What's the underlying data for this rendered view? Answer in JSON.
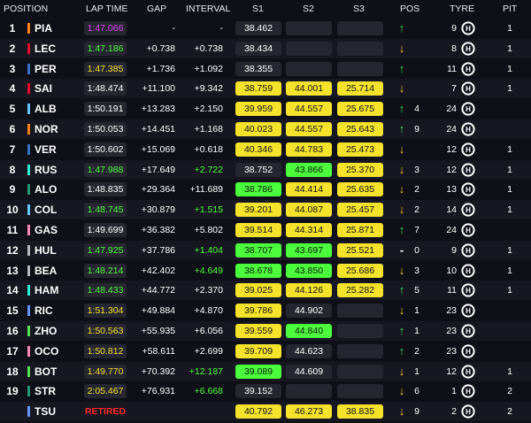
{
  "headers": {
    "position": "POSITION",
    "lap_time": "LAP TIME",
    "gap": "GAP",
    "interval": "INTERVAL",
    "s1": "S1",
    "s2": "S2",
    "s3": "S3",
    "pos": "POS",
    "tyre": "TYRE",
    "pit": "PIT"
  },
  "colors": {
    "purple": "#e040fb",
    "green": "#4cff3c",
    "yellow": "#f5e22a",
    "gray_box": "#262631",
    "white": "#ffffff",
    "red": "#ff2a2a",
    "arrow_up": "#3dd95a",
    "arrow_down": "#f5c518",
    "tyre_hard": "#ffffff"
  },
  "rows": [
    {
      "pos": "1",
      "code": "PIA",
      "team": "#ff8000",
      "lap": "1:47.066",
      "lap_c": "purple",
      "gap": "-",
      "int": "-",
      "int_c": "white",
      "s1": "38.462",
      "s1_c": "gray",
      "s2": "",
      "s2_c": "gray",
      "s3": "",
      "s3_c": "gray",
      "arrow": "↑",
      "arrow_c": "up",
      "gl": "",
      "age": "9",
      "tyre": "H",
      "pit": "1"
    },
    {
      "pos": "2",
      "code": "LEC",
      "team": "#e8002d",
      "lap": "1:47.186",
      "lap_c": "green",
      "gap": "+0.738",
      "int": "+0.738",
      "int_c": "white",
      "s1": "38.434",
      "s1_c": "gray",
      "s2": "",
      "s2_c": "gray",
      "s3": "",
      "s3_c": "gray",
      "arrow": "↓",
      "arrow_c": "down",
      "gl": "",
      "age": "8",
      "tyre": "H",
      "pit": "1"
    },
    {
      "pos": "3",
      "code": "PER",
      "team": "#3671c6",
      "lap": "1:47.385",
      "lap_c": "yellow",
      "gap": "+1.736",
      "int": "+1.092",
      "int_c": "white",
      "s1": "38.355",
      "s1_c": "gray",
      "s2": "",
      "s2_c": "gray",
      "s3": "",
      "s3_c": "gray",
      "arrow": "↑",
      "arrow_c": "up",
      "gl": "",
      "age": "11",
      "tyre": "H",
      "pit": "1"
    },
    {
      "pos": "4",
      "code": "SAI",
      "team": "#e8002d",
      "lap": "1:48.474",
      "lap_c": "gray",
      "gap": "+11.100",
      "int": "+9.342",
      "int_c": "white",
      "s1": "38.759",
      "s1_c": "yellow",
      "s2": "44.001",
      "s2_c": "yellow",
      "s3": "25.714",
      "s3_c": "yellow",
      "arrow": "↓",
      "arrow_c": "down",
      "gl": "",
      "age": "7",
      "tyre": "H",
      "pit": "1"
    },
    {
      "pos": "5",
      "code": "ALB",
      "team": "#64c4ff",
      "lap": "1:50.191",
      "lap_c": "gray",
      "gap": "+13.283",
      "int": "+2.150",
      "int_c": "white",
      "s1": "39.959",
      "s1_c": "yellow",
      "s2": "44.557",
      "s2_c": "yellow",
      "s3": "25.675",
      "s3_c": "yellow",
      "arrow": "↑",
      "arrow_c": "up",
      "gl": "4",
      "age": "24",
      "tyre": "H",
      "pit": ""
    },
    {
      "pos": "6",
      "code": "NOR",
      "team": "#ff8000",
      "lap": "1:50.053",
      "lap_c": "gray",
      "gap": "+14.451",
      "int": "+1.168",
      "int_c": "white",
      "s1": "40.023",
      "s1_c": "yellow",
      "s2": "44.557",
      "s2_c": "yellow",
      "s3": "25.643",
      "s3_c": "yellow",
      "arrow": "↑",
      "arrow_c": "up",
      "gl": "9",
      "age": "24",
      "tyre": "H",
      "pit": ""
    },
    {
      "pos": "7",
      "code": "VER",
      "team": "#3671c6",
      "lap": "1:50.602",
      "lap_c": "gray",
      "gap": "+15.069",
      "int": "+0.618",
      "int_c": "white",
      "s1": "40.346",
      "s1_c": "yellow",
      "s2": "44.783",
      "s2_c": "yellow",
      "s3": "25.473",
      "s3_c": "yellow",
      "arrow": "↓",
      "arrow_c": "down",
      "gl": "",
      "age": "12",
      "tyre": "H",
      "pit": "1"
    },
    {
      "pos": "8",
      "code": "RUS",
      "team": "#27f4d2",
      "lap": "1:47.988",
      "lap_c": "green",
      "gap": "+17.649",
      "int": "+2.722",
      "int_c": "green",
      "s1": "38.752",
      "s1_c": "gray",
      "s2": "43.866",
      "s2_c": "green",
      "s3": "25.370",
      "s3_c": "yellow",
      "arrow": "↓",
      "arrow_c": "down",
      "gl": "3",
      "age": "12",
      "tyre": "H",
      "pit": "1"
    },
    {
      "pos": "9",
      "code": "ALO",
      "team": "#229971",
      "lap": "1:48.835",
      "lap_c": "gray",
      "gap": "+29.364",
      "int": "+11.689",
      "int_c": "white",
      "s1": "38.786",
      "s1_c": "green",
      "s2": "44.414",
      "s2_c": "yellow",
      "s3": "25.635",
      "s3_c": "yellow",
      "arrow": "↓",
      "arrow_c": "down",
      "gl": "2",
      "age": "13",
      "tyre": "H",
      "pit": "1"
    },
    {
      "pos": "10",
      "code": "COL",
      "team": "#64c4ff",
      "lap": "1:48.745",
      "lap_c": "green",
      "gap": "+30.879",
      "int": "+1.515",
      "int_c": "green",
      "s1": "39.201",
      "s1_c": "yellow",
      "s2": "44.087",
      "s2_c": "yellow",
      "s3": "25.457",
      "s3_c": "yellow",
      "arrow": "↓",
      "arrow_c": "down",
      "gl": "2",
      "age": "14",
      "tyre": "H",
      "pit": "1"
    },
    {
      "pos": "11",
      "code": "GAS",
      "team": "#ff87bc",
      "lap": "1:49.699",
      "lap_c": "gray",
      "gap": "+36.382",
      "int": "+5.802",
      "int_c": "white",
      "s1": "39.514",
      "s1_c": "yellow",
      "s2": "44.314",
      "s2_c": "yellow",
      "s3": "25.871",
      "s3_c": "yellow",
      "arrow": "↑",
      "arrow_c": "up",
      "gl": "7",
      "age": "24",
      "tyre": "H",
      "pit": ""
    },
    {
      "pos": "12",
      "code": "HUL",
      "team": "#b6babd",
      "lap": "1:47.925",
      "lap_c": "green",
      "gap": "+37.786",
      "int": "+1.404",
      "int_c": "green",
      "s1": "38.707",
      "s1_c": "green",
      "s2": "43.697",
      "s2_c": "green",
      "s3": "25.521",
      "s3_c": "yellow",
      "arrow": "-",
      "arrow_c": "neutral",
      "gl": "0",
      "age": "9",
      "tyre": "H",
      "pit": "1"
    },
    {
      "pos": "13",
      "code": "BEA",
      "team": "#b6babd",
      "lap": "1:48.214",
      "lap_c": "green",
      "gap": "+42.402",
      "int": "+4.649",
      "int_c": "green",
      "s1": "38.678",
      "s1_c": "green",
      "s2": "43.850",
      "s2_c": "green",
      "s3": "25.686",
      "s3_c": "yellow",
      "arrow": "↓",
      "arrow_c": "down",
      "gl": "3",
      "age": "10",
      "tyre": "H",
      "pit": "1"
    },
    {
      "pos": "14",
      "code": "HAM",
      "team": "#27f4d2",
      "lap": "1:48.433",
      "lap_c": "green",
      "gap": "+44.772",
      "int": "+2.370",
      "int_c": "white",
      "s1": "39.025",
      "s1_c": "yellow",
      "s2": "44.126",
      "s2_c": "yellow",
      "s3": "25.282",
      "s3_c": "yellow",
      "arrow": "↑",
      "arrow_c": "up",
      "gl": "5",
      "age": "11",
      "tyre": "H",
      "pit": "1"
    },
    {
      "pos": "15",
      "code": "RIC",
      "team": "#6692ff",
      "lap": "1:51.304",
      "lap_c": "yellow",
      "gap": "+49.884",
      "int": "+4.870",
      "int_c": "white",
      "s1": "39.786",
      "s1_c": "yellow",
      "s2": "44.902",
      "s2_c": "gray",
      "s3": "",
      "s3_c": "gray",
      "arrow": "↓",
      "arrow_c": "down",
      "gl": "1",
      "age": "23",
      "tyre": "H",
      "pit": ""
    },
    {
      "pos": "16",
      "code": "ZHO",
      "team": "#52e252",
      "lap": "1:50.563",
      "lap_c": "yellow",
      "gap": "+55.935",
      "int": "+6.056",
      "int_c": "white",
      "s1": "39.559",
      "s1_c": "yellow",
      "s2": "44.840",
      "s2_c": "green",
      "s3": "",
      "s3_c": "gray",
      "arrow": "↑",
      "arrow_c": "up",
      "gl": "1",
      "age": "23",
      "tyre": "H",
      "pit": ""
    },
    {
      "pos": "17",
      "code": "OCO",
      "team": "#ff87bc",
      "lap": "1:50.812",
      "lap_c": "yellow",
      "gap": "+58.611",
      "int": "+2.699",
      "int_c": "white",
      "s1": "39.709",
      "s1_c": "yellow",
      "s2": "44.623",
      "s2_c": "gray",
      "s3": "",
      "s3_c": "gray",
      "arrow": "↑",
      "arrow_c": "up",
      "gl": "2",
      "age": "23",
      "tyre": "H",
      "pit": ""
    },
    {
      "pos": "18",
      "code": "BOT",
      "team": "#52e252",
      "lap": "1:49.770",
      "lap_c": "yellow",
      "gap": "+70.392",
      "int": "+12.187",
      "int_c": "green",
      "s1": "39.089",
      "s1_c": "green",
      "s2": "44.609",
      "s2_c": "gray",
      "s3": "",
      "s3_c": "gray",
      "arrow": "↓",
      "arrow_c": "down",
      "gl": "1",
      "age": "12",
      "tyre": "H",
      "pit": "1"
    },
    {
      "pos": "19",
      "code": "STR",
      "team": "#229971",
      "lap": "2:05.467",
      "lap_c": "yellow",
      "gap": "+76.931",
      "int": "+6.668",
      "int_c": "green",
      "s1": "39.152",
      "s1_c": "gray",
      "s2": "",
      "s2_c": "gray",
      "s3": "",
      "s3_c": "gray",
      "arrow": "↓",
      "arrow_c": "down",
      "gl": "6",
      "age": "1",
      "tyre": "H",
      "pit": "2"
    },
    {
      "pos": "",
      "code": "TSU",
      "team": "#6692ff",
      "lap": "RETIRED",
      "lap_c": "retired",
      "gap": "",
      "int": "",
      "int_c": "white",
      "s1": "40.792",
      "s1_c": "yellow",
      "s2": "46.273",
      "s2_c": "yellow",
      "s3": "38.835",
      "s3_c": "yellow",
      "arrow": "↓",
      "arrow_c": "down",
      "gl": "9",
      "age": "2",
      "tyre": "H",
      "pit": "2"
    }
  ]
}
